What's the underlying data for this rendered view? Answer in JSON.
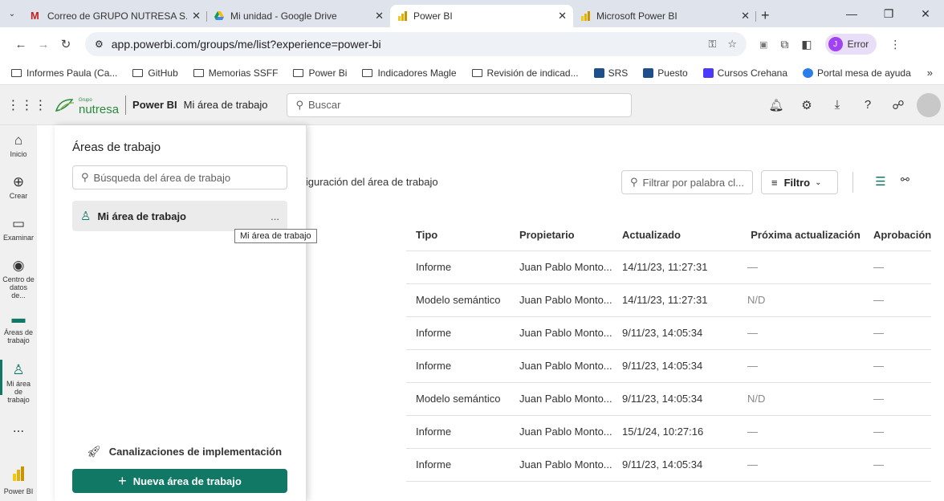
{
  "browser": {
    "tabs": [
      {
        "title": "Correo de GRUPO NUTRESA S.A",
        "icon": "gmail-icon",
        "color": "#c5221f"
      },
      {
        "title": "Mi unidad - Google Drive",
        "icon": "google-drive-icon",
        "color": "#1a73e8"
      },
      {
        "title": "Power BI",
        "icon": "power-bi-icon",
        "color": "#f2c811"
      },
      {
        "title": "Microsoft Power BI",
        "icon": "power-bi-icon",
        "color": "#f2c811"
      }
    ],
    "url": "app.powerbi.com/groups/me/list?experience=power-bi",
    "profile_label": "Error",
    "profile_initial": "J",
    "bookmarks": [
      "Informes Paula (Ca...",
      "GitHub",
      "Memorias SSFF",
      "Power Bi",
      "Indicadores Magle",
      "Revisión de indicad...",
      "SRS",
      "Puesto",
      "Cursos Crehana",
      "Portal mesa de ayuda"
    ]
  },
  "app": {
    "brand_small": "Grupo",
    "brand": "nutresa",
    "product": "Power BI",
    "workspace_title": "Mi área de trabajo",
    "search_placeholder": "Buscar"
  },
  "leftnav": [
    {
      "label": "Inicio",
      "icon": "home-icon"
    },
    {
      "label": "Crear",
      "icon": "plus-circle-icon"
    },
    {
      "label": "Examinar",
      "icon": "folder-icon"
    },
    {
      "label": "Centro de datos de...",
      "icon": "data-hub-icon"
    },
    {
      "label": "Áreas de trabajo",
      "icon": "workspaces-icon"
    },
    {
      "label": "Mi área de trabajo",
      "icon": "person-icon"
    },
    {
      "label": "...",
      "icon": "more-icon"
    },
    {
      "label": "Power BI",
      "icon": "power-bi-icon"
    }
  ],
  "panel": {
    "title": "Áreas de trabajo",
    "search_placeholder": "Búsqueda del área de trabajo",
    "item_label": "Mi área de trabajo",
    "item_more": "...",
    "tooltip": "Mi área de trabajo",
    "pipelines": "Canalizaciones de implementación",
    "new_workspace": "Nueva área de trabajo"
  },
  "main": {
    "config_label": "nfiguración del área de trabajo",
    "filter_placeholder": "Filtrar por palabra cl...",
    "filter_button": "Filtro",
    "table": {
      "headers": [
        "Tipo",
        "Propietario",
        "Actualizado",
        "Próxima actualización",
        "Aprobación"
      ],
      "rows": [
        [
          "Informe",
          "Juan Pablo Monto...",
          "14/11/23, 11:27:31",
          "—",
          "—"
        ],
        [
          "Modelo semántico",
          "Juan Pablo Monto...",
          "14/11/23, 11:27:31",
          "N/D",
          "—"
        ],
        [
          "Informe",
          "Juan Pablo Monto...",
          "9/11/23, 14:05:34",
          "—",
          "—"
        ],
        [
          "Informe",
          "Juan Pablo Monto...",
          "9/11/23, 14:05:34",
          "—",
          "—"
        ],
        [
          "Modelo semántico",
          "Juan Pablo Monto...",
          "9/11/23, 14:05:34",
          "N/D",
          "—"
        ],
        [
          "Informe",
          "Juan Pablo Monto...",
          "15/1/24, 10:27:16",
          "—",
          "—"
        ],
        [
          "Informe",
          "Juan Pablo Monto...",
          "9/11/23, 14:05:34",
          "—",
          "—"
        ]
      ]
    }
  }
}
